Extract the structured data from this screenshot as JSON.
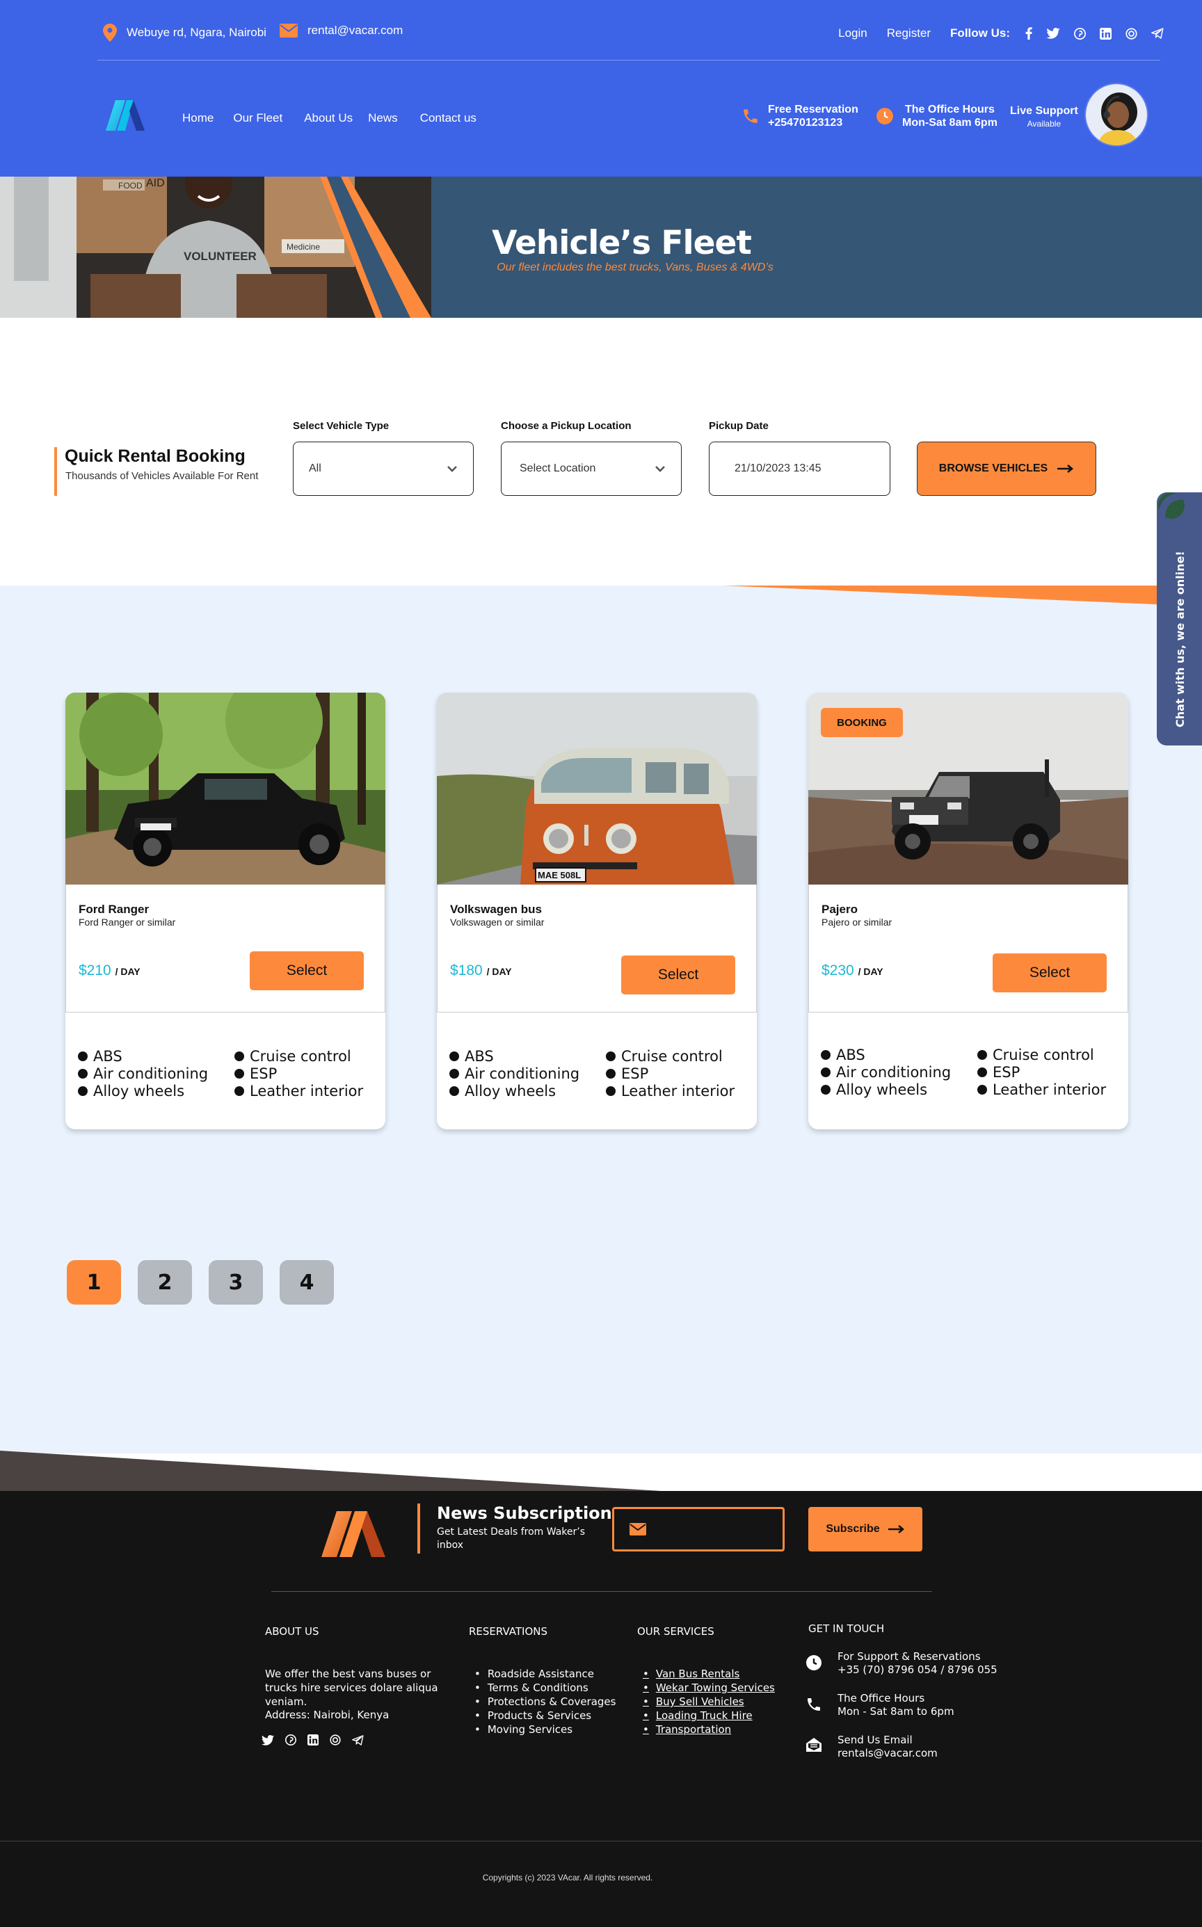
{
  "header": {
    "address": "Webuye rd, Ngara, Nairobi",
    "email": "rental@vacar.com",
    "login": "Login",
    "register": "Register",
    "follow_us": "Follow Us:",
    "nav": [
      "Home",
      "Our Fleet",
      "About Us",
      "News",
      "Contact us"
    ],
    "reservation_title": "Free Reservation",
    "reservation_phone": "+25470123123",
    "hours_title": "The Office Hours",
    "hours_value": "Mon-Sat 8am 6pm",
    "support_title": "Live Support",
    "support_status": "Available",
    "brand_color": "#3d63e6",
    "accent_color": "#fd8a3c"
  },
  "hero": {
    "title": "Vehicle’s Fleet",
    "subtitle": "Our fleet includes the best trucks, Vans, Buses & 4WD’s",
    "shirt_text": "VOLUNTEER",
    "box_labels": [
      "FOOD",
      "AID",
      "Medicine"
    ]
  },
  "booking": {
    "title": "Quick Rental Booking",
    "subtitle": "Thousands of Vehicles Available For Rent",
    "vehicle_type_label": "Select  Vehicle Type",
    "vehicle_type_value": "All",
    "location_label": "Choose a Pickup Location",
    "location_value": "Select Location",
    "date_label": "Pickup Date",
    "date_value": "21/10/2023  13:45",
    "browse_label": "BROWSE VEHICLES"
  },
  "chat_widget": "Chat with us, we are online!",
  "cars": [
    {
      "name": "Ford Ranger",
      "sub": "Ford Ranger or similar",
      "price": "$210",
      "unit": "/ DAY",
      "select": "Select",
      "plate": "",
      "features": [
        "ABS",
        "Cruise control",
        "Air conditioning",
        "ESP",
        "Alloy wheels",
        "Leather interior"
      ]
    },
    {
      "name": "Volkswagen bus",
      "sub": "Volkswagen or similar",
      "price": "$180",
      "unit": "/ DAY",
      "select": "Select",
      "plate": "MAE 508L",
      "features": [
        "ABS",
        "Cruise control",
        "Air conditioning",
        "ESP",
        "Alloy wheels",
        "Leather interior"
      ]
    },
    {
      "name": "Pajero",
      "sub": "Pajero or similar",
      "price": "$230",
      "unit": "/ DAY",
      "select": "Select",
      "badge": "BOOKING",
      "plate": "",
      "features": [
        "ABS",
        "Cruise control",
        "Air conditioning",
        "ESP",
        "Alloy wheels",
        "Leather interior"
      ]
    }
  ],
  "pagination": [
    "1",
    "2",
    "3",
    "4"
  ],
  "footer": {
    "newsletter_title": "News Subscription",
    "newsletter_sub": "Get Latest Deals from Waker’s inbox",
    "subscribe": "Subscribe",
    "about_heading": "ABOUT US",
    "about_text": "We offer the best vans buses or trucks hire services dolare aliqua veniam.",
    "address": "Address: Nairobi, Kenya",
    "reservations_heading": "RESERVATIONS",
    "reservations": [
      "Roadside Assistance",
      "Terms & Conditions",
      "Protections & Coverages",
      "Products & Services",
      "Moving Services"
    ],
    "services_heading": "OUR SERVICES",
    "services": [
      "Van Bus Rentals",
      "Wekar Towing Services",
      "Buy Sell Vehicles",
      "Loading Truck Hire",
      "Transportation"
    ],
    "touch_heading": "GET IN TOUCH",
    "support_label": "For Support & Reservations",
    "support_phones": "+35 (70) 8796 054 / 8796 055",
    "hours_label": "The Office Hours",
    "hours_value": "Mon - Sat 8am to 6pm",
    "email_label": "Send Us Email",
    "email_value": "rentals@vacar.com",
    "copyright": "Copyrights (c) 2023 VAcar. All rights reserved."
  }
}
